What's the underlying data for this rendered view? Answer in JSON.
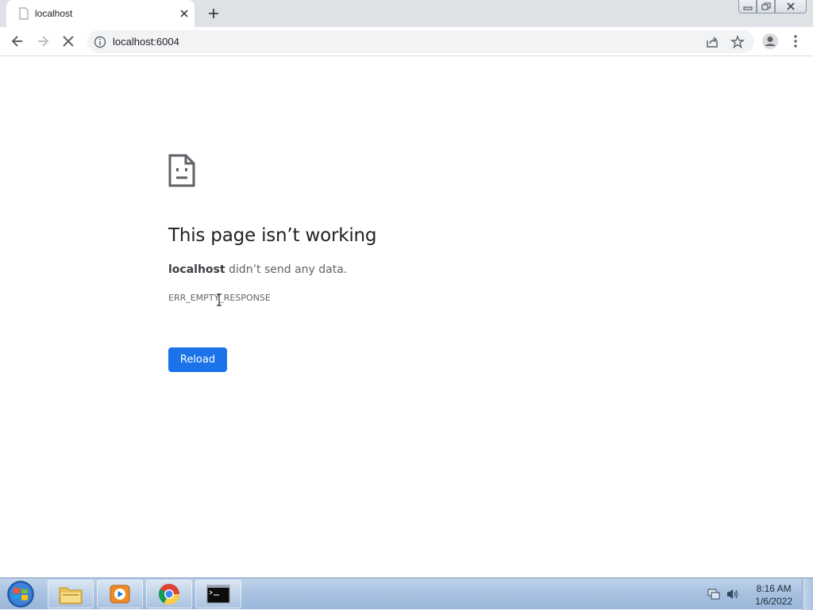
{
  "browser": {
    "tab": {
      "title": "localhost",
      "favicon": "page-icon",
      "close_icon": "close-icon"
    },
    "new_tab_icon": "plus-icon",
    "window_controls": [
      "minimize-icon",
      "restore-icon",
      "close-icon"
    ],
    "toolbar": {
      "back_icon": "back-arrow-icon",
      "forward_icon": "forward-arrow-icon",
      "stop_icon": "stop-loading-icon",
      "url": "localhost:6004",
      "site_info_icon": "info-icon",
      "share_icon": "share-icon",
      "bookmark_icon": "star-icon",
      "profile_icon": "profile-icon",
      "menu_icon": "kebab-menu-icon"
    }
  },
  "error_page": {
    "icon": "sad-page-icon",
    "title": "This page isn’t working",
    "host": "localhost",
    "message": " didn’t send any data.",
    "code": "ERR_EMPTY_RESPONSE",
    "reload_label": "Reload",
    "accent_color": "#1a73e8"
  },
  "taskbar": {
    "start_icon": "windows-start-icon",
    "apps": [
      "file-explorer-icon",
      "media-player-icon",
      "chrome-icon",
      "command-prompt-icon"
    ],
    "tray_icons": [
      "network-icon",
      "volume-icon"
    ],
    "time": "8:16 AM",
    "date": "1/6/2022"
  }
}
